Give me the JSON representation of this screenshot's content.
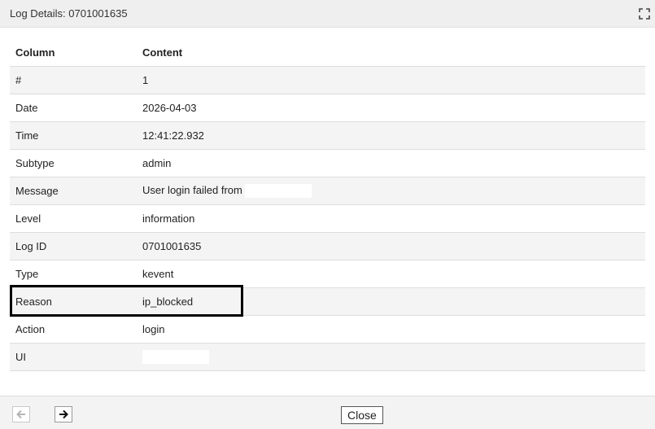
{
  "dialog": {
    "title": "Log Details: 0701001635"
  },
  "table": {
    "headers": [
      "Column",
      "Content"
    ],
    "rows": [
      {
        "column": "#",
        "content": "1"
      },
      {
        "column": "Date",
        "content": "2026-04-03"
      },
      {
        "column": "Time",
        "content": "12:41:22.932"
      },
      {
        "column": "Subtype",
        "content": "admin"
      },
      {
        "column": "Message",
        "content": "User login failed from"
      },
      {
        "column": "Level",
        "content": "information"
      },
      {
        "column": "Log ID",
        "content": "0701001635"
      },
      {
        "column": "Type",
        "content": "kevent"
      },
      {
        "column": "Reason",
        "content": "ip_blocked"
      },
      {
        "column": "Action",
        "content": "login"
      },
      {
        "column": "UI",
        "content": ""
      }
    ]
  },
  "footer": {
    "close_label": "Close"
  },
  "icons": {
    "maximize": "maximize-icon",
    "prev": "arrow-left-icon",
    "next": "arrow-right-icon"
  },
  "colors": {
    "title_bar": "#efefef",
    "stripe": "#f4f4f4",
    "highlight": "#000000"
  }
}
